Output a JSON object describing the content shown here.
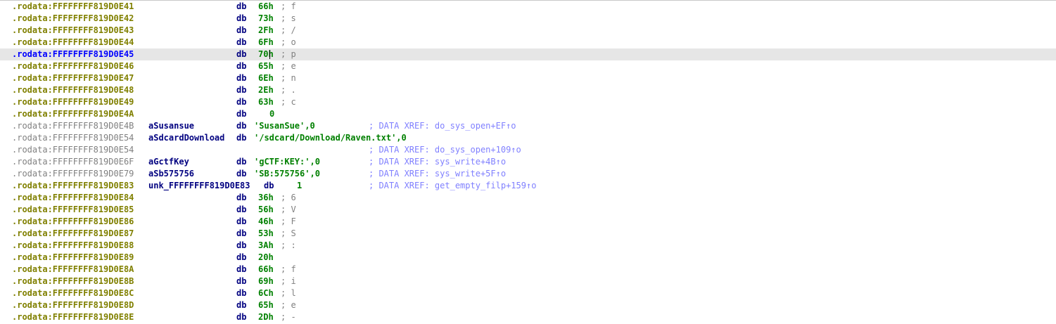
{
  "lines": [
    {
      "addr": ".rodata:FFFFFFFF819D0E41",
      "kind": "code",
      "mnem": "db",
      "operand": "66h",
      "comment": "; f"
    },
    {
      "addr": ".rodata:FFFFFFFF819D0E42",
      "kind": "code",
      "mnem": "db",
      "operand": "73h",
      "comment": "; s"
    },
    {
      "addr": ".rodata:FFFFFFFF819D0E43",
      "kind": "code",
      "mnem": "db",
      "operand": "2Fh",
      "comment": "; /"
    },
    {
      "addr": ".rodata:FFFFFFFF819D0E44",
      "kind": "code",
      "mnem": "db",
      "operand": "6Fh",
      "comment": "; o"
    },
    {
      "addr": ".rodata:FFFFFFFF819D0E45",
      "kind": "current",
      "mnem": "db",
      "operand": "70h",
      "comment": "; p"
    },
    {
      "addr": ".rodata:FFFFFFFF819D0E46",
      "kind": "code",
      "mnem": "db",
      "operand": "65h",
      "comment": "; e"
    },
    {
      "addr": ".rodata:FFFFFFFF819D0E47",
      "kind": "code",
      "mnem": "db",
      "operand": "6Eh",
      "comment": "; n"
    },
    {
      "addr": ".rodata:FFFFFFFF819D0E48",
      "kind": "code",
      "mnem": "db",
      "operand": "2Eh",
      "comment": "; ."
    },
    {
      "addr": ".rodata:FFFFFFFF819D0E49",
      "kind": "code",
      "mnem": "db",
      "operand": "63h",
      "comment": "; c"
    },
    {
      "addr": ".rodata:FFFFFFFF819D0E4A",
      "kind": "code",
      "mnem": "db",
      "operand": "0",
      "operand_style": "num",
      "comment": ""
    },
    {
      "addr": ".rodata:FFFFFFFF819D0E4B",
      "kind": "data",
      "name": "aSusansue",
      "mnem": "db",
      "operand": "'SusanSue',0",
      "operand_style": "str",
      "xref": "; DATA XREF: do_sys_open+EF↑o"
    },
    {
      "addr": ".rodata:FFFFFFFF819D0E54",
      "kind": "data",
      "name": "aSdcardDownload",
      "mnem": "db",
      "mnem_style": "inline",
      "operand": "'/sdcard/Download/Raven.txt',0",
      "operand_style": "str2"
    },
    {
      "addr": ".rodata:FFFFFFFF819D0E54",
      "kind": "data",
      "xref": "; DATA XREF: do_sys_open+109↑o"
    },
    {
      "addr": ".rodata:FFFFFFFF819D0E6F",
      "kind": "data",
      "name": "aGctfKey",
      "mnem": "db",
      "operand": "'gCTF:KEY:',0",
      "operand_style": "str",
      "xref": "; DATA XREF: sys_write+4B↑o"
    },
    {
      "addr": ".rodata:FFFFFFFF819D0E79",
      "kind": "data",
      "name": "aSb575756",
      "mnem": "db",
      "operand": "'SB:575756',0",
      "operand_style": "str",
      "xref": "; DATA XREF: sys_write+5F↑o"
    },
    {
      "addr": ".rodata:FFFFFFFF819D0E83",
      "kind": "code",
      "name": "unk_FFFFFFFF819D0E83",
      "mnem": "db",
      "mnem_style": "unk",
      "operand": "1",
      "operand_style": "unk",
      "xref": "; DATA XREF: get_empty_filp+159↑o"
    },
    {
      "addr": ".rodata:FFFFFFFF819D0E84",
      "kind": "code",
      "mnem": "db",
      "operand": "36h",
      "comment": "; 6"
    },
    {
      "addr": ".rodata:FFFFFFFF819D0E85",
      "kind": "code",
      "mnem": "db",
      "operand": "56h",
      "comment": "; V"
    },
    {
      "addr": ".rodata:FFFFFFFF819D0E86",
      "kind": "code",
      "mnem": "db",
      "operand": "46h",
      "comment": "; F"
    },
    {
      "addr": ".rodata:FFFFFFFF819D0E87",
      "kind": "code",
      "mnem": "db",
      "operand": "53h",
      "comment": "; S"
    },
    {
      "addr": ".rodata:FFFFFFFF819D0E88",
      "kind": "code",
      "mnem": "db",
      "operand": "3Ah",
      "comment": "; :"
    },
    {
      "addr": ".rodata:FFFFFFFF819D0E89",
      "kind": "code",
      "mnem": "db",
      "operand": "20h",
      "comment": ""
    },
    {
      "addr": ".rodata:FFFFFFFF819D0E8A",
      "kind": "code",
      "mnem": "db",
      "operand": "66h",
      "comment": "; f"
    },
    {
      "addr": ".rodata:FFFFFFFF819D0E8B",
      "kind": "code",
      "mnem": "db",
      "operand": "69h",
      "comment": "; i"
    },
    {
      "addr": ".rodata:FFFFFFFF819D0E8C",
      "kind": "code",
      "mnem": "db",
      "operand": "6Ch",
      "comment": "; l"
    },
    {
      "addr": ".rodata:FFFFFFFF819D0E8D",
      "kind": "code",
      "mnem": "db",
      "operand": "65h",
      "comment": "; e"
    },
    {
      "addr": ".rodata:FFFFFFFF819D0E8E",
      "kind": "code",
      "mnem": "db",
      "operand": "2Dh",
      "comment": "; -"
    }
  ]
}
